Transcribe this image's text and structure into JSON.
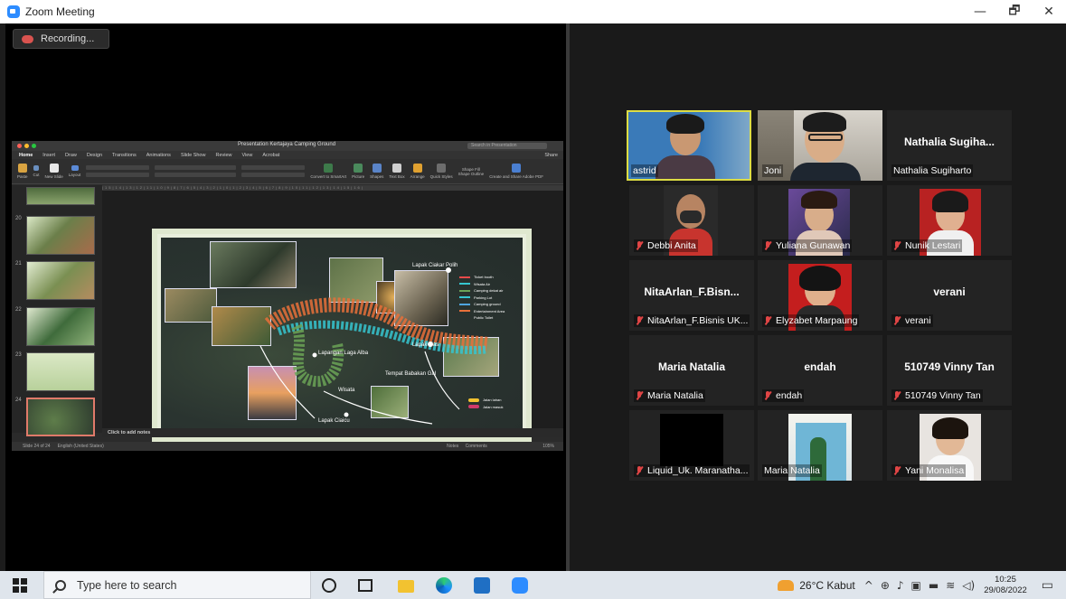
{
  "window": {
    "title": "Zoom Meeting",
    "controls": [
      "—",
      "🗗",
      "✕"
    ]
  },
  "recording": {
    "label": "Recording..."
  },
  "ppt": {
    "title": "Presentation Kertajaya Camping Ground",
    "search_placeholder": "Search in Presentation",
    "menu": [
      "Home",
      "Insert",
      "Draw",
      "Design",
      "Transitions",
      "Animations",
      "Slide Show",
      "Review",
      "View",
      "Acrobat"
    ],
    "share": "Share",
    "ribbon": {
      "paste": "Paste",
      "cut": "Cut",
      "copy": "Copy",
      "format": "Format",
      "new_slide": "New Slide",
      "layout": "Layout",
      "reset": "Reset",
      "section": "Section",
      "convert": "Convert to SmartArt",
      "picture": "Picture",
      "shapes": "Shapes",
      "textbox": "Text Box",
      "arrange": "Arrange",
      "quick_styles": "Quick Styles",
      "shape_fill": "Shape Fill",
      "shape_outline": "Shape Outline",
      "adobe": "Create and Share Adobe PDF"
    },
    "thumb_numbers": [
      "20",
      "21",
      "22",
      "23",
      "24"
    ],
    "notes_placeholder": "Click to add notes",
    "status": {
      "slide": "Slide 24 of 24",
      "lang": "English (United States)",
      "notes": "Notes",
      "comments": "Comments",
      "zoom": "105%"
    },
    "slide": {
      "labels": {
        "lapak_pojok": "Lapak Ciakar Polih",
        "lapak_mas": "Lapak Mas",
        "lapangan": "Lapangan Laga Alba",
        "tempat": "Tempat Babakan Gal",
        "wisata": "Wisata",
        "lapak_bawah": "Lapak Ciaicu"
      },
      "legend": [
        "Ticket booth",
        "Wisata Air",
        "Camping dekat air",
        "Parking Lot",
        "Camping ground",
        "Entertainment Area",
        "Public Toilet"
      ],
      "legend2": [
        "Jalan lahan",
        "Jalan masuk"
      ]
    }
  },
  "participants": [
    {
      "name": "astrid",
      "type": "video",
      "muted": false,
      "active": true
    },
    {
      "name": "Joni",
      "type": "video",
      "muted": false,
      "active": false
    },
    {
      "name": "Nathalia Sugiharto",
      "big": "Nathalia Sugiha...",
      "type": "name",
      "muted": false,
      "active": false
    },
    {
      "name": "Debbi Anita",
      "type": "video",
      "muted": true,
      "active": false
    },
    {
      "name": "Yuliana Gunawan",
      "type": "video",
      "muted": true,
      "active": false
    },
    {
      "name": "Nunik Lestari",
      "type": "video",
      "muted": true,
      "active": false
    },
    {
      "name": "NitaArlan_F.Bisnis UK...",
      "big": "NitaArlan_F.Bisn...",
      "type": "name",
      "muted": true,
      "active": false
    },
    {
      "name": "Elyzabet Marpaung",
      "type": "video",
      "muted": true,
      "active": false
    },
    {
      "name": "verani",
      "big": "verani",
      "type": "name",
      "muted": true,
      "active": false
    },
    {
      "name": "Maria Natalia",
      "big": "Maria Natalia",
      "type": "name",
      "muted": true,
      "active": false
    },
    {
      "name": "endah",
      "big": "endah",
      "type": "name",
      "muted": true,
      "active": false
    },
    {
      "name": "510749 Vinny Tan",
      "big": "510749 Vinny Tan",
      "type": "name",
      "muted": true,
      "active": false
    },
    {
      "name": "Liquid_Uk. Maranatha...",
      "type": "video",
      "muted": true,
      "active": false
    },
    {
      "name": "Maria Natalia",
      "type": "video",
      "muted": false,
      "active": false
    },
    {
      "name": "Yani Monalisa",
      "type": "video",
      "muted": true,
      "active": false
    }
  ],
  "taskbar": {
    "search_placeholder": "Type here to search",
    "weather": "26°C  Kabut",
    "time": "10:25",
    "date": "29/08/2022"
  }
}
